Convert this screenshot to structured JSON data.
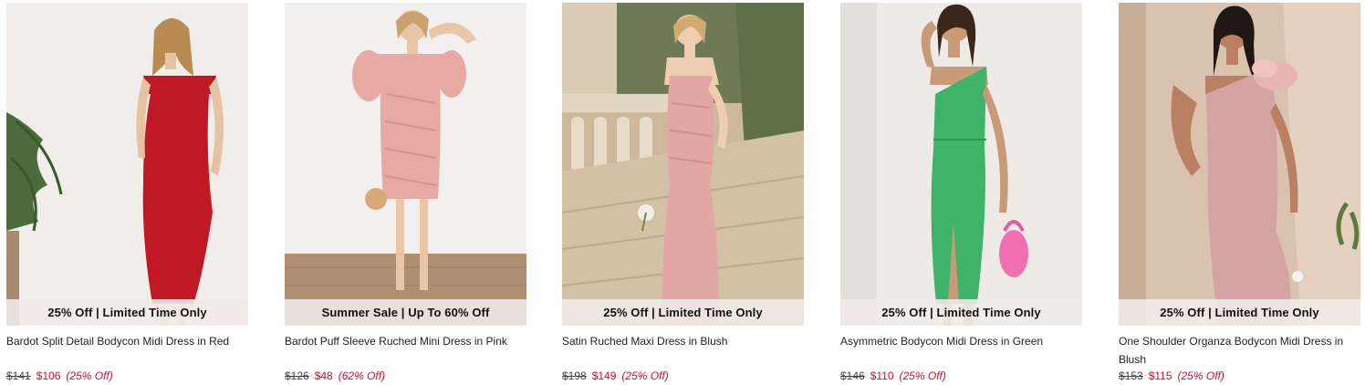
{
  "products": [
    {
      "badge": "25% Off | Limited Time Only",
      "name": "Bardot Split Detail Bodycon Midi Dress in Red",
      "was_price": "$141",
      "now_price": "$106",
      "discount": "(25% Off)",
      "dress_color": "#c01824"
    },
    {
      "badge": "Summer Sale | Up To 60% Off",
      "name": "Bardot Puff Sleeve Ruched Mini Dress in Pink",
      "was_price": "$126",
      "now_price": "$48",
      "discount": "(62% Off)",
      "dress_color": "#e7aaa2"
    },
    {
      "badge": "25% Off | Limited Time Only",
      "name": "Satin Ruched Maxi Dress in Blush",
      "was_price": "$198",
      "now_price": "$149",
      "discount": "(25% Off)",
      "dress_color": "#e3a7a3"
    },
    {
      "badge": "25% Off | Limited Time Only",
      "name": "Asymmetric Bodycon Midi Dress in Green",
      "was_price": "$146",
      "now_price": "$110",
      "discount": "(25% Off)",
      "dress_color": "#3fb36a"
    },
    {
      "badge": "25% Off | Limited Time Only",
      "name": "One Shoulder Organza Bodycon Midi Dress in Blush",
      "was_price": "$153",
      "now_price": "$115",
      "discount": "(25% Off)",
      "dress_color": "#d4a3a3"
    }
  ]
}
